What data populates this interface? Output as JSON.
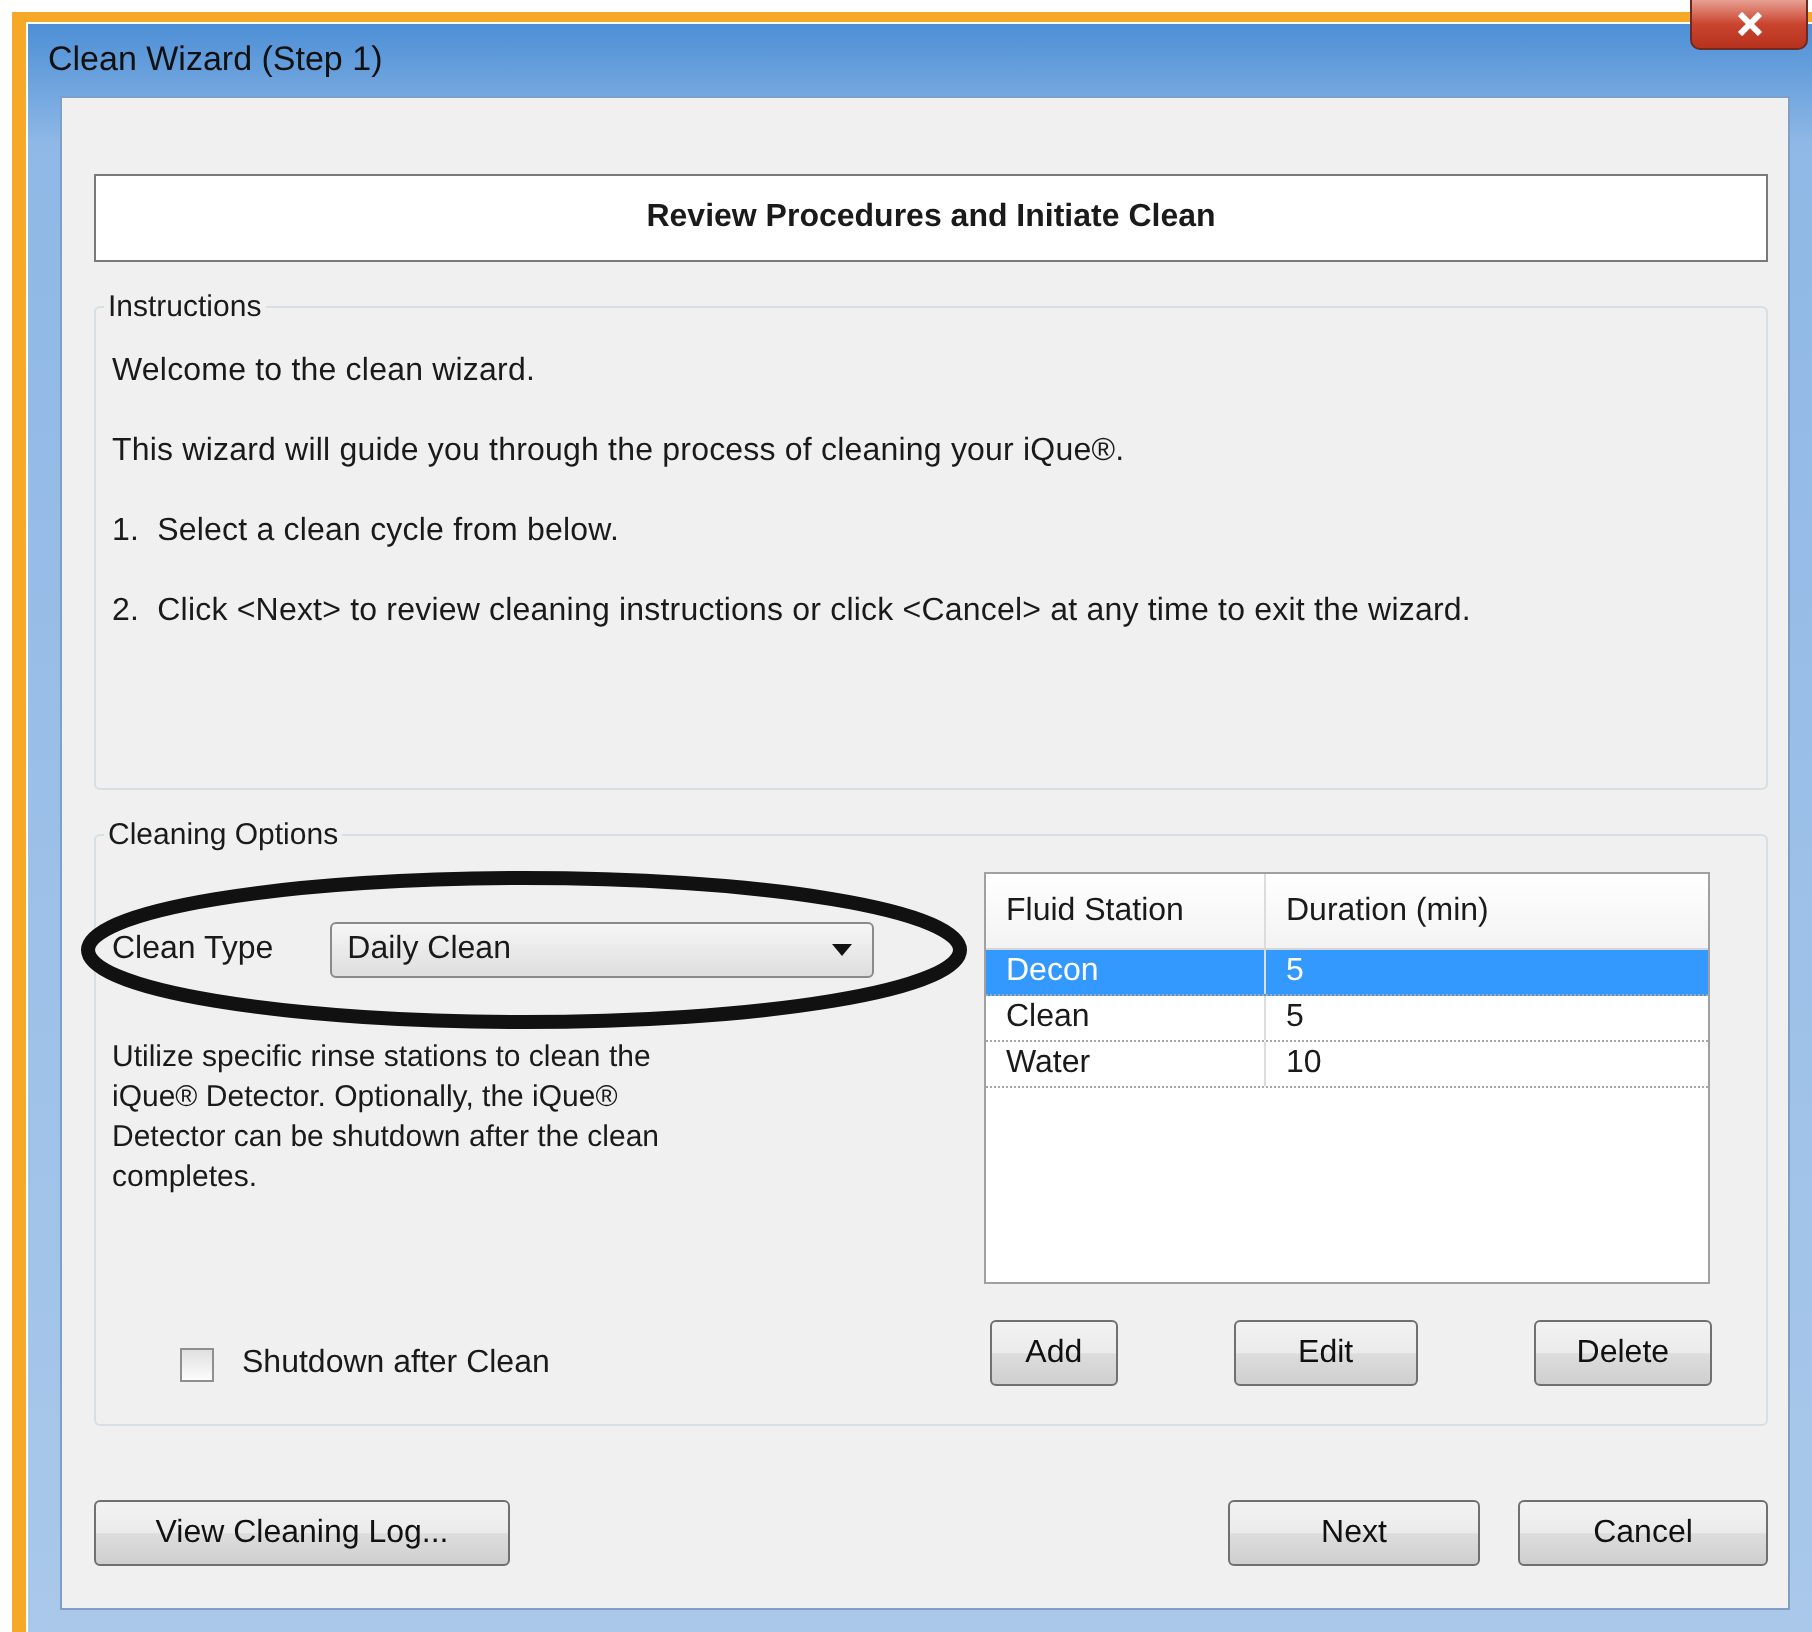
{
  "window": {
    "title": "Clean Wizard (Step 1)"
  },
  "header": "Review Procedures and Initiate Clean",
  "instructions": {
    "legend": "Instructions",
    "lines": [
      "Welcome to the clean wizard.",
      "This wizard will guide you through the process of cleaning your iQue®.",
      "1.  Select a clean cycle from below.",
      "2.  Click <Next> to review cleaning instructions or click <Cancel> at any time to exit the wizard."
    ]
  },
  "cleaning_options": {
    "legend": "Cleaning Options",
    "clean_type": {
      "label": "Clean Type",
      "value": "Daily Clean"
    },
    "description": "Utilize specific rinse stations to clean the iQue® Detector. Optionally, the iQue® Detector can be shutdown after the clean completes.",
    "shutdown": {
      "label": "Shutdown after Clean",
      "checked": false
    },
    "table": {
      "columns": [
        "Fluid Station",
        "Duration (min)"
      ],
      "rows": [
        {
          "cells": [
            "Decon",
            "5"
          ],
          "selected": true
        },
        {
          "cells": [
            "Clean",
            "5"
          ],
          "selected": false
        },
        {
          "cells": [
            "Water",
            "10"
          ],
          "selected": false
        }
      ]
    },
    "buttons": [
      "Add",
      "Edit",
      "Delete"
    ]
  },
  "footer": {
    "left_button": "View Cleaning Log...",
    "right_buttons": [
      "Next",
      "Cancel"
    ]
  },
  "annotations": [
    {
      "kind": "ellipse"
    }
  ]
}
